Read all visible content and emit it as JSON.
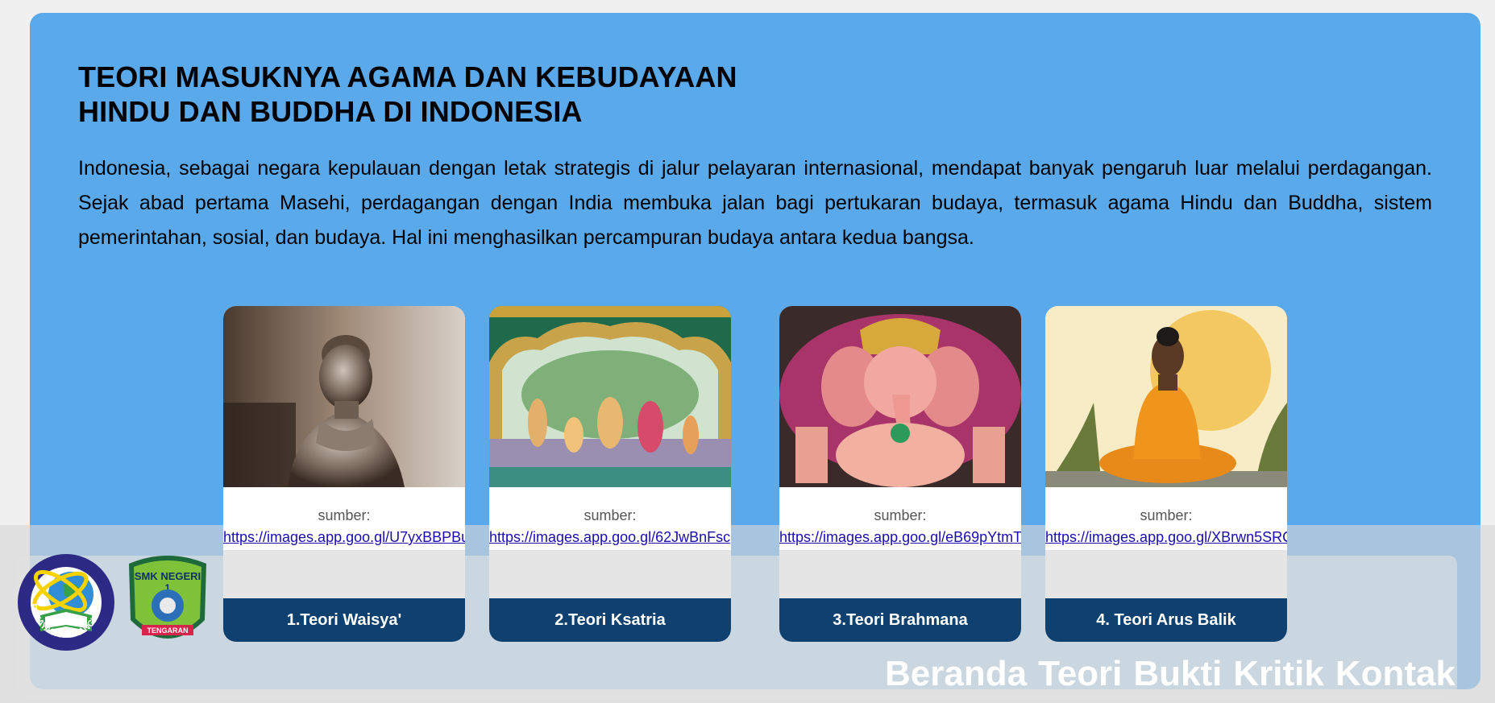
{
  "header": {
    "title_line1": "TEORI MASUKNYA AGAMA DAN KEBUDAYAAN",
    "title_line2": "HINDU DAN BUDDHA DI INDONESIA"
  },
  "intro": "Indonesia, sebagai negara kepulauan dengan letak strategis di jalur pelayaran internasional, mendapat banyak pengaruh luar melalui perdagangan. Sejak abad pertama Masehi, perdagangan dengan India membuka jalan bagi pertukaran budaya, termasuk agama Hindu dan Buddha, sistem pemerintahan, sosial, dan budaya. Hal ini menghasilkan percampuran budaya antara kedua bangsa.",
  "cards": [
    {
      "source_label": "sumber:",
      "source_url": "https://images.app.goo.gl/U7yxBBPBu",
      "button": "1.Teori Waisya'",
      "image": "buddha-statue-photo"
    },
    {
      "source_label": "sumber:",
      "source_url": "https://images.app.goo.gl/62JwBnFsc",
      "button": "2.Teori Ksatria",
      "image": "hindu-deities-relief"
    },
    {
      "source_label": "sumber:",
      "source_url": "https://images.app.goo.gl/eB69pYtmT",
      "button": "3.Teori Brahmana",
      "image": "ganesha-statue"
    },
    {
      "source_label": "sumber:",
      "source_url": "https://images.app.goo.gl/XBrwn5SRC",
      "button": "4. Teori Arus Balik",
      "image": "meditating-buddha-illustration"
    }
  ],
  "logos": {
    "rpl": {
      "text": "REKAYASA PERANGKAT LUNAK",
      "icon": "rpl-logo"
    },
    "smk": {
      "top": "SMK NEGERI",
      "number": "1",
      "bottom": "TENGARAN",
      "icon": "smk-logo"
    }
  },
  "nav": {
    "items": [
      "Beranda",
      "Teori",
      "Bukti",
      "Kritik",
      "Kontak"
    ]
  },
  "colors": {
    "panel": "#5aa9ea",
    "button": "#0f4170",
    "link": "#1a0dab"
  }
}
